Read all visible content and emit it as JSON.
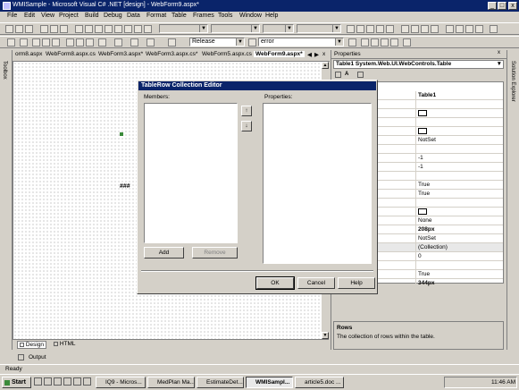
{
  "window": {
    "title": "WMISample - Microsoft Visual C# .NET [design] - WebForm9.aspx*",
    "controls": [
      "_",
      "□",
      "x"
    ]
  },
  "menu": [
    "File",
    "Edit",
    "View",
    "Project",
    "Build",
    "Debug",
    "Data",
    "Format",
    "Table",
    "Frames",
    "Tools",
    "Window",
    "Help"
  ],
  "toolbar": {
    "config": "Release",
    "find": "error"
  },
  "toolbox_label": "Toolbox",
  "doc_tabs": [
    "orm8.aspx",
    "WebForm8.aspx.cs",
    "WebForm3.aspx*",
    "WebForm3.aspx.cs*",
    "WebForm5.aspx.cs",
    "WebForm9.aspx*"
  ],
  "designer": {
    "marker": "###",
    "view_tabs": [
      "Design",
      "HTML"
    ]
  },
  "properties": {
    "header": "Properties",
    "object": "Table1  System.Web.UI.WebControls.Table",
    "values": [
      "Table1",
      "",
      "",
      "NotSet",
      "",
      "-1",
      "-1",
      "",
      "True",
      "True",
      "",
      "",
      "None",
      "208px",
      "NotSet",
      "(Collection)",
      "0",
      "",
      "True",
      "344px"
    ],
    "desc_title": "Rows",
    "desc_text": "The collection of rows within the table."
  },
  "solution_explorer_label": "Solution Explorer",
  "output_label": "Output",
  "status": "Ready",
  "dialog": {
    "title": "TableRow Collection Editor",
    "members_label": "Members:",
    "properties_label": "Properties:",
    "add": "Add",
    "remove": "Remove",
    "ok": "OK",
    "cancel": "Cancel",
    "help": "Help"
  },
  "taskbar": {
    "start": "Start",
    "tasks": [
      "IQ9 - Micros...",
      "MedPlan Ma...",
      "EstimateDet...",
      "WMISampl...",
      "article5.doc ..."
    ],
    "clock": "11:46 AM"
  }
}
